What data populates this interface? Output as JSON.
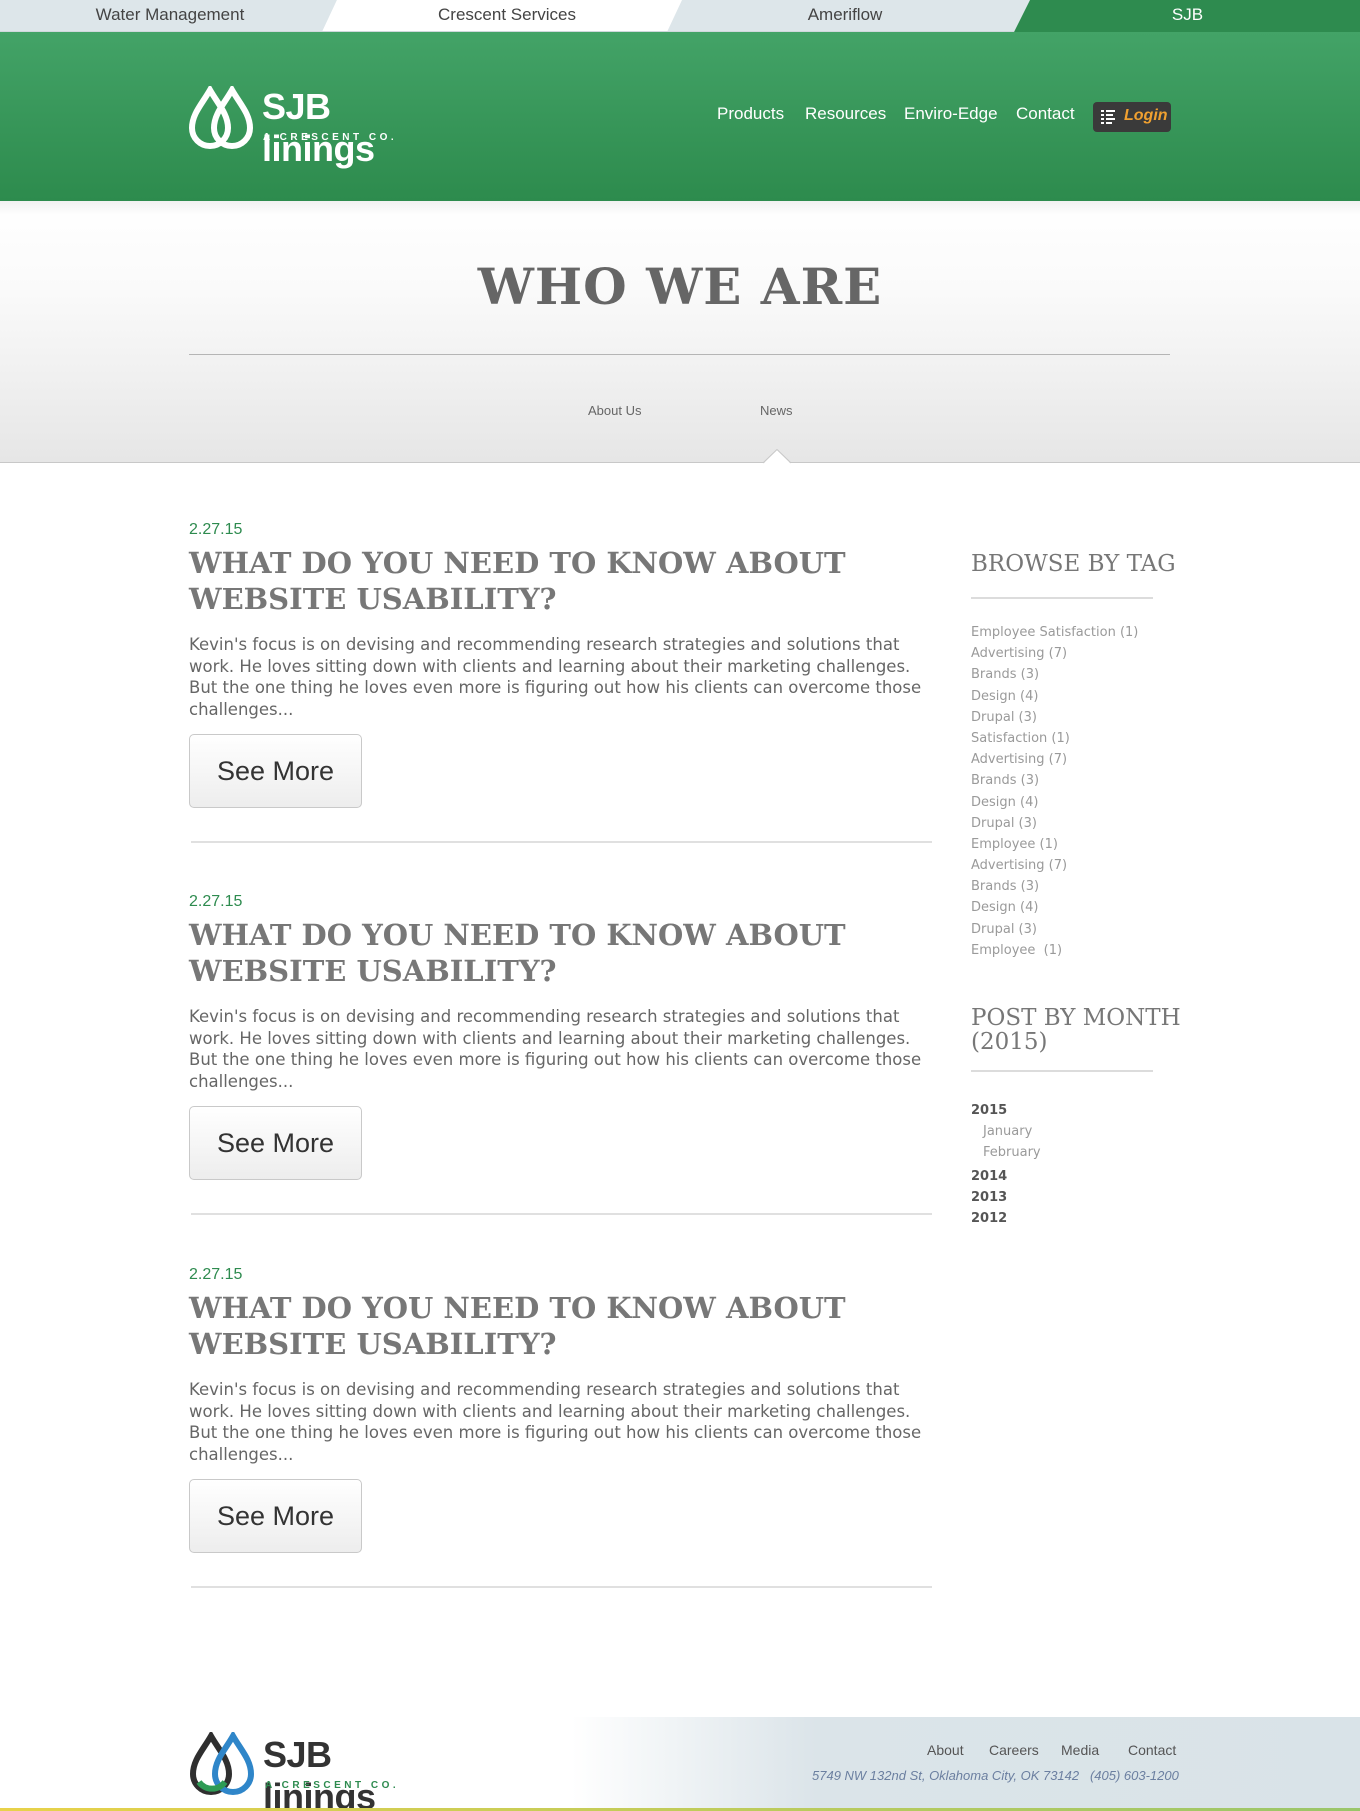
{
  "brand_bar": {
    "items": [
      "Water Management",
      "Crescent Services",
      "Ameriflow",
      "SJB"
    ],
    "active_index": 3,
    "colors": {
      "inactive_light": "#dde6ea",
      "inactive_white": "#ffffff",
      "active": "#2e8b4f"
    }
  },
  "header": {
    "logo_name": "SJB linings",
    "logo_sub": "A CRESCENT CO.",
    "nav": [
      "Products",
      "Resources",
      "Enviro-Edge",
      "Contact"
    ],
    "login_label": "Login",
    "colors": {
      "green_top": "#43a367",
      "green_bottom": "#2d8b4d",
      "login_text": "#f0a030"
    }
  },
  "page": {
    "title": "WHO WE ARE",
    "subnav": [
      "About Us",
      "News"
    ],
    "active_subnav": "News"
  },
  "articles": [
    {
      "date": "2.27.15",
      "title": "WHAT DO YOU NEED TO KNOW ABOUT WEBSITE USABILITY?",
      "excerpt": "Kevin's focus is on devising and recommending research strategies and solutions that work. He loves sitting down with clients and learning about their marketing challenges. But the one thing he loves even more is figuring out how his clients can overcome those challenges...",
      "more_label": "See More"
    },
    {
      "date": "2.27.15",
      "title": "WHAT DO YOU NEED TO KNOW ABOUT WEBSITE USABILITY?",
      "excerpt": "Kevin's focus is on devising and recommending research strategies and solutions that work. He loves sitting down with clients and learning about their marketing challenges. But the one thing he loves even more is figuring out how his clients can overcome those challenges...",
      "more_label": "See More"
    },
    {
      "date": "2.27.15",
      "title": "WHAT DO YOU NEED TO KNOW ABOUT WEBSITE USABILITY?",
      "excerpt": "Kevin's focus is on devising and recommending research strategies and solutions that work. He loves sitting down with clients and learning about their marketing challenges. But the one thing he loves even more is figuring out how his clients can overcome those challenges...",
      "more_label": "See More"
    }
  ],
  "sidebar": {
    "tags_title": "BROWSE BY TAG",
    "tags": [
      "Employee Satisfaction (1)",
      "Advertising (7)",
      "Brands (3)",
      "Design (4)",
      "Drupal (3)",
      "Satisfaction (1)",
      "Advertising (7)",
      "Brands (3)",
      "Design (4)",
      "Drupal (3)",
      "Employee (1)",
      "Advertising (7)",
      "Brands (3)",
      "Design (4)",
      "Drupal (3)",
      "Employee  (1)"
    ],
    "months_title_line1": "POST BY MONTH",
    "months_title_line2": "(2015)",
    "archive": {
      "year_2015": "2015",
      "months_2015": [
        "January",
        "February"
      ],
      "year_2014": "2014",
      "year_2013": "2013",
      "year_2012": "2012"
    }
  },
  "footer": {
    "logo_name": "SJB linings",
    "logo_sub": "A CRESCENT CO.",
    "links": [
      "About",
      "Careers",
      "Media",
      "Contact"
    ],
    "address": "5749 NW 132nd St, Oklahoma City, OK 73142   (405) 603-1200"
  },
  "icons": {
    "logo": "droplets-logo-icon",
    "login": "list-icon",
    "caret": "caret-up-icon"
  }
}
